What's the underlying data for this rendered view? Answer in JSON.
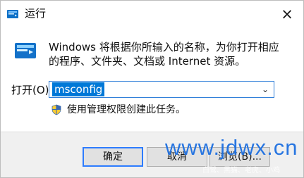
{
  "window": {
    "title": "运行",
    "close_symbol": "×",
    "description": "Windows 将根据你所输入的名称，为你打开相应的程序、文件夹、文档或 Internet 资源。",
    "open_label": "打开(O):",
    "command_value": "msconfig",
    "dropdown_arrow": "⌄",
    "admin_text": "使用管理权限创建此任务。",
    "buttons": {
      "ok": "确定",
      "cancel": "取消",
      "browse": "浏览(B)..."
    },
    "icons": {
      "title_icon": "run-icon",
      "app_icon": "run-app-icon",
      "shield_icon": "admin-shield-icon",
      "close_icon": "close-icon",
      "dropdown_icon": "chevron-down-icon"
    },
    "watermark": "www.jdwx.cn",
    "watermark_sub": "白鹭、黑猫、老虎、小鸡"
  },
  "colors": {
    "accent": "#0078d7",
    "focus_border": "#2f7ed8",
    "footer_bg": "#f0f0f0",
    "watermark": "#1d6fe0"
  }
}
